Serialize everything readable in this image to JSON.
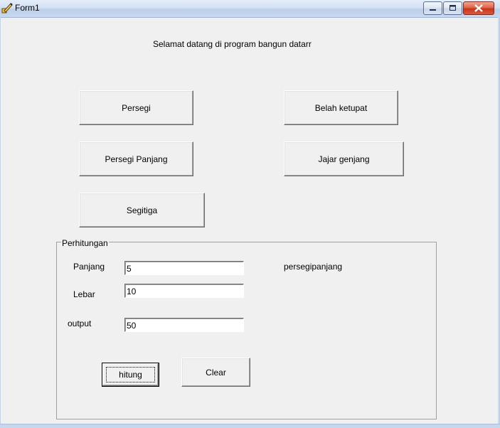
{
  "window": {
    "title": "Form1",
    "icon": "vb-form-icon"
  },
  "heading": "Selamat datang di program bangun datarr",
  "shape_buttons": {
    "persegi": "Persegi",
    "belah_ketupat": "Belah ketupat",
    "persegi_panjang": "Persegi Panjang",
    "jajar_genjang": "Jajar genjang",
    "segitiga": "Segitiga"
  },
  "calculation": {
    "group_label": "Perhitungan",
    "panjang_label": "Panjang",
    "panjang_value": "5",
    "lebar_label": "Lebar",
    "lebar_value": "10",
    "output_label": "output",
    "output_value": "50",
    "shape_name": "persegipanjang",
    "hitung_label": "hitung",
    "clear_label": "Clear"
  }
}
